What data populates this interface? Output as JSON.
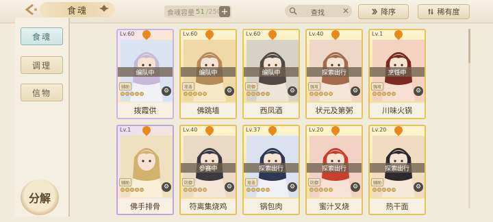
{
  "header": {
    "title": "食魂",
    "capacity_label": "食魂容量",
    "capacity_current": "51",
    "capacity_total": "/250",
    "search_label": "查找",
    "sort_label": "降序",
    "rarity_label": "稀有度"
  },
  "sidebar": {
    "tabs": [
      {
        "label": "食魂",
        "active": true
      },
      {
        "label": "调理",
        "active": false
      },
      {
        "label": "信物",
        "active": false
      }
    ],
    "decompose_label": "分解"
  },
  "cards": [
    {
      "level": "Lv.60",
      "status": "编队中",
      "tag": "辅助",
      "name": "拨霞供",
      "stars": 5,
      "rarity": "r1"
    },
    {
      "level": "Lv.60",
      "status": "编队中",
      "tag": "攻击",
      "name": "佛跳墙",
      "stars": 5,
      "rarity": "r2"
    },
    {
      "level": "Lv.60",
      "status": "编队中",
      "tag": "防御",
      "name": "西凤酒",
      "stars": 5,
      "rarity": "r2"
    },
    {
      "level": "Lv.40",
      "status": "探索出行",
      "tag": "强攻",
      "name": "状元及第粥",
      "stars": 5,
      "rarity": "r2"
    },
    {
      "level": "Lv.1",
      "status": "烹饪中",
      "tag": "强攻",
      "name": "川味火锅",
      "stars": 5,
      "rarity": "r2"
    },
    {
      "level": "Lv.1",
      "status": "",
      "tag": "辅助",
      "name": "佛手排骨",
      "stars": 5,
      "rarity": "r3"
    },
    {
      "level": "Lv.40",
      "status": "参赛中",
      "tag": "防御",
      "name": "符离集烧鸡",
      "stars": 5,
      "rarity": "r2"
    },
    {
      "level": "Lv.37",
      "status": "探索出行",
      "tag": "攻击",
      "name": "锅包肉",
      "stars": 5,
      "rarity": "r2"
    },
    {
      "level": "Lv.20",
      "status": "探索出行",
      "tag": "防御",
      "name": "蜜汁叉烧",
      "stars": 5,
      "rarity": "r2"
    },
    {
      "level": "Lv.20",
      "status": "探索出行",
      "tag": "辅助",
      "name": "热干面",
      "stars": 5,
      "rarity": "r2"
    }
  ],
  "icons": {
    "back": "back-arrow-icon",
    "search": "search-icon",
    "sort": "sort-arrow-icon",
    "rarity": "filter-icon"
  },
  "colors": {
    "accent": "#e5c25a",
    "selected_tab": "#4d7674"
  }
}
